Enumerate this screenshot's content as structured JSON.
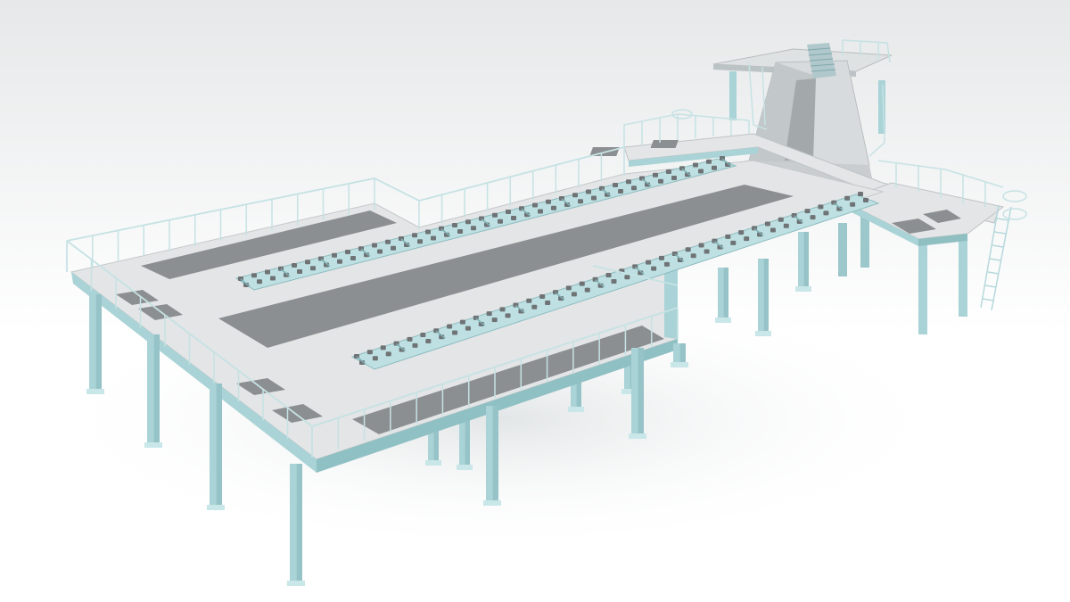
{
  "scene": {
    "subject": "steel-platform-structure",
    "colors": {
      "background_top": "#e6e8e9",
      "background_bottom": "#ffffff",
      "steel_frame": "#a9d3d6",
      "steel_frame_light": "#c9e6e8",
      "steel_frame_shadow": "#86b7bb",
      "deck_surface": "#e3e5e6",
      "deck_edge": "#bfc4c6",
      "dark_panel": "#8c8f91",
      "handrail": "#d5eaec",
      "hopper": "#d8dbdd",
      "hopper_shadow": "#aeb3b5"
    }
  }
}
